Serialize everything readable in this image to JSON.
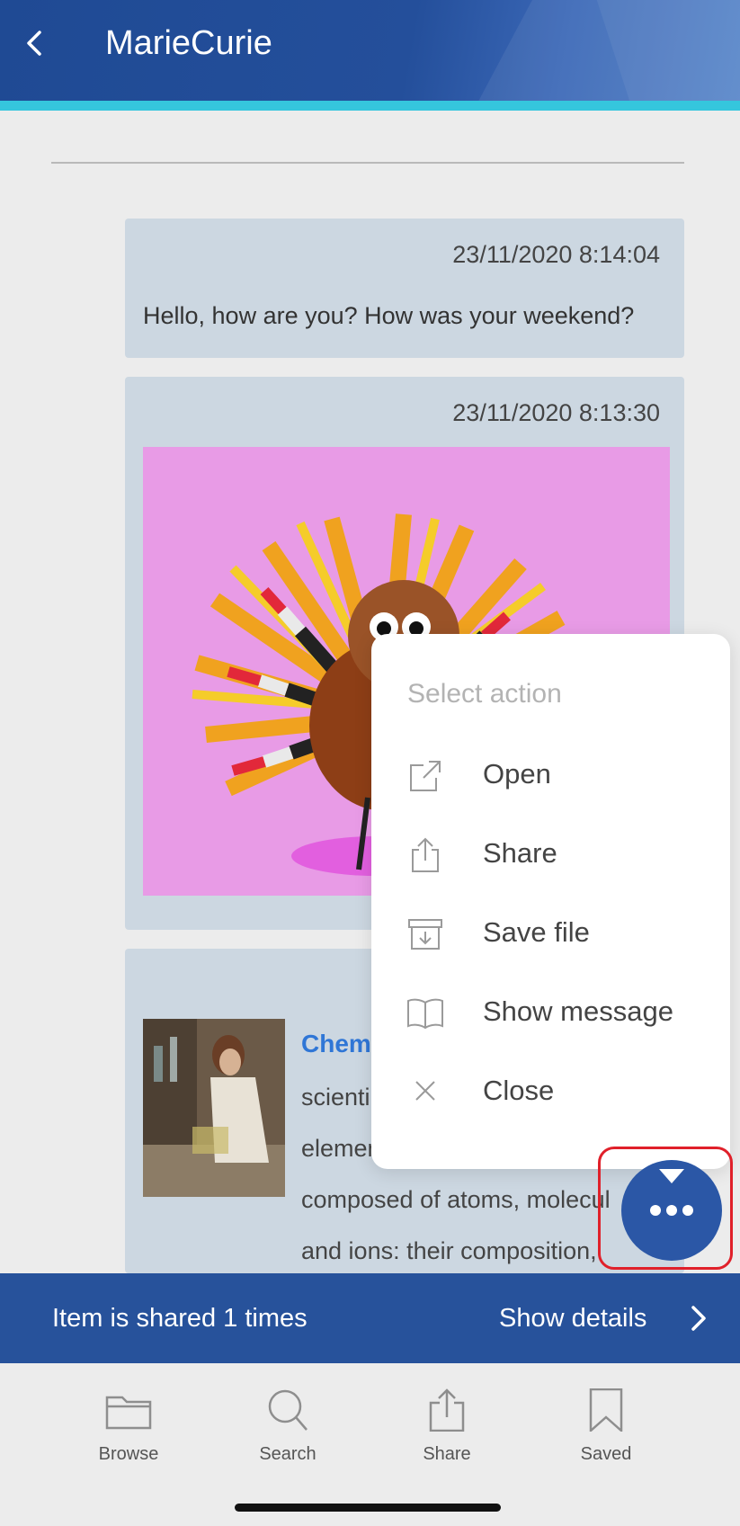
{
  "header": {
    "title": "MarieCurie"
  },
  "messages": [
    {
      "timestamp": "23/11/2020 8:14:04",
      "text": "Hello, how are you? How was your weekend?"
    },
    {
      "timestamp": "23/11/2020 8:13:30"
    }
  ],
  "article": {
    "link_title": "Chem",
    "lines": [
      "scienti",
      "elemen",
      "composed of atoms, molecul",
      "and ions: their composition,"
    ]
  },
  "action_menu": {
    "title": "Select action",
    "items": [
      {
        "label": "Open",
        "icon": "open-external-icon"
      },
      {
        "label": "Share",
        "icon": "share-icon"
      },
      {
        "label": "Save file",
        "icon": "save-file-icon"
      },
      {
        "label": "Show message",
        "icon": "book-icon"
      },
      {
        "label": "Close",
        "icon": "close-icon"
      }
    ]
  },
  "share_bar": {
    "text": "Item is shared 1 times",
    "details_label": "Show details"
  },
  "bottom_nav": [
    {
      "label": "Browse",
      "icon": "folder-icon"
    },
    {
      "label": "Search",
      "icon": "search-icon"
    },
    {
      "label": "Share",
      "icon": "share-icon"
    },
    {
      "label": "Saved",
      "icon": "bookmark-icon"
    }
  ],
  "colors": {
    "header": "#244f9b",
    "accent": "#35c6dd",
    "bubble": "#ccd7e1",
    "link": "#2f76d6",
    "highlight": "#e0202a"
  }
}
